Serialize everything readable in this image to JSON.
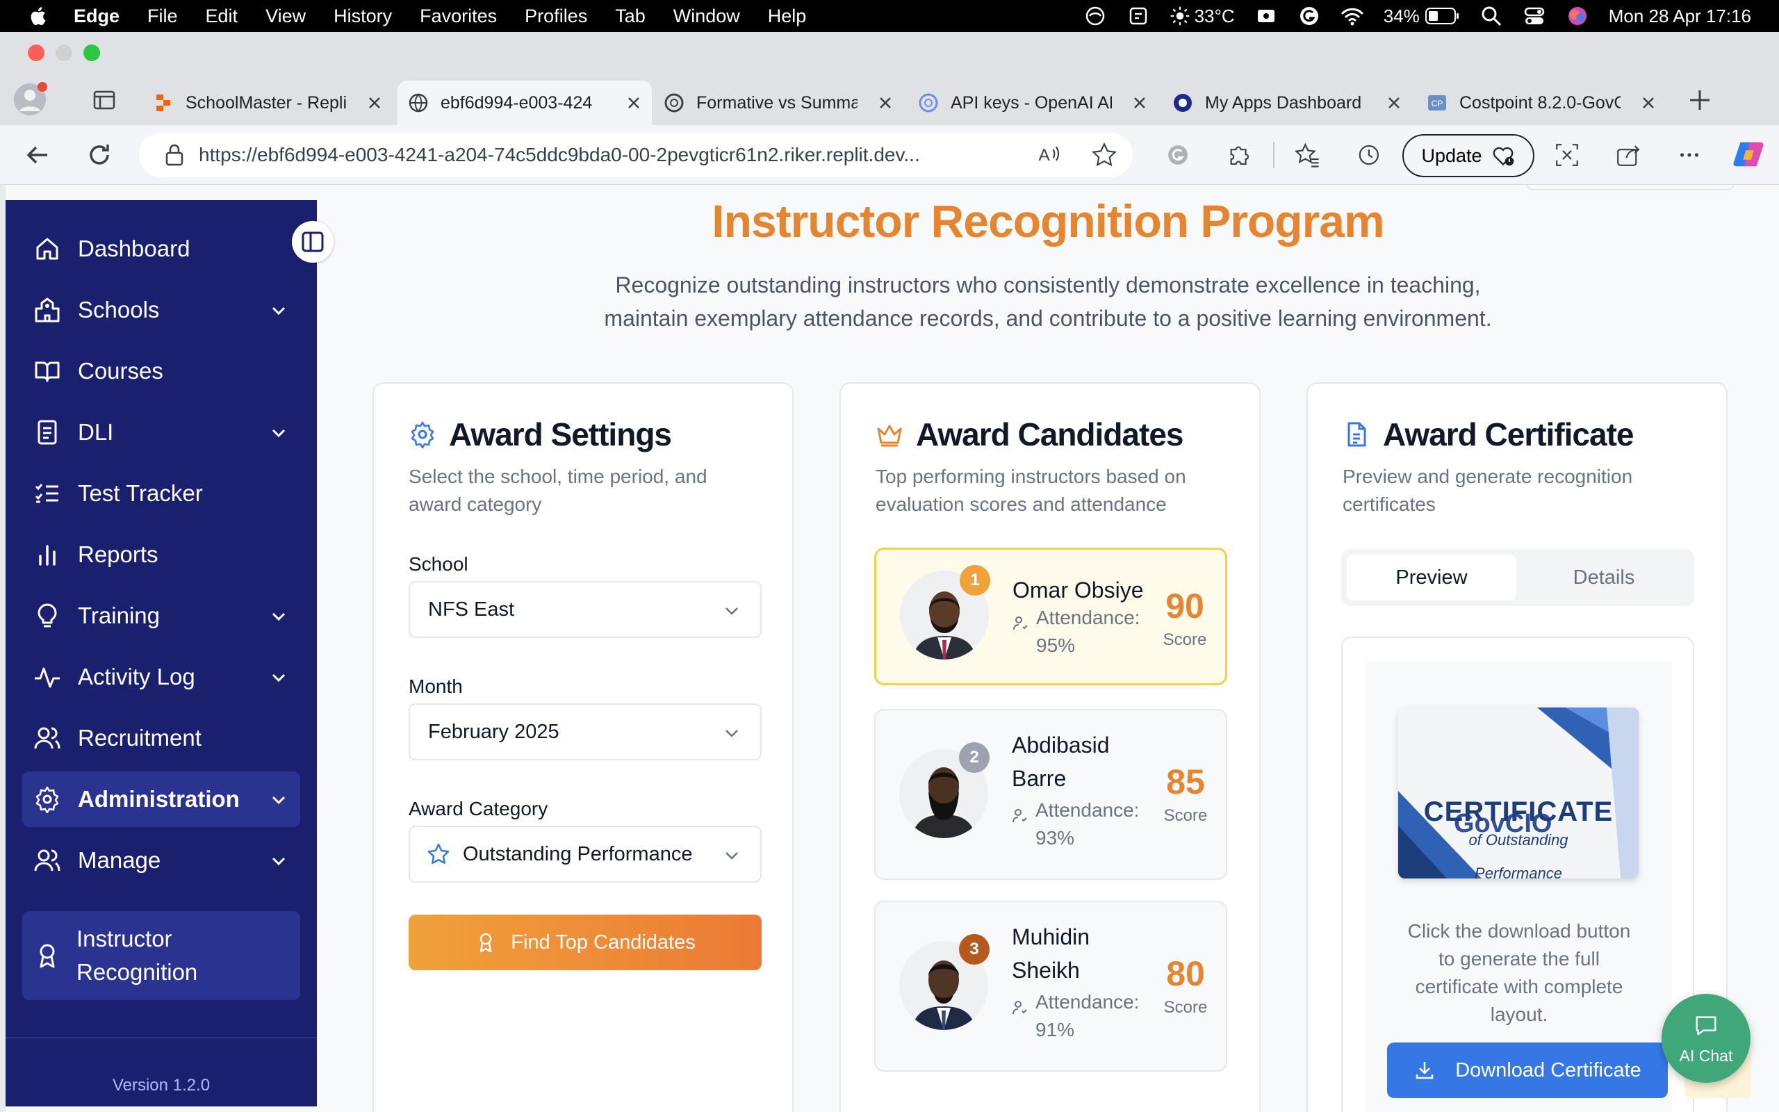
{
  "menubar": {
    "app": "Edge",
    "items": [
      "File",
      "Edit",
      "View",
      "History",
      "Favorites",
      "Profiles",
      "Tab",
      "Window",
      "Help"
    ],
    "temperature": "33°C",
    "battery": "34%",
    "datetime": "Mon 28 Apr  17:16"
  },
  "tabs": [
    {
      "title": "SchoolMaster - Replit",
      "icon": "replit-icon"
    },
    {
      "title": "ebf6d994-e003-424",
      "icon": "globe-icon"
    },
    {
      "title": "Formative vs Summat",
      "icon": "openai-icon"
    },
    {
      "title": "API keys - OpenAI AP",
      "icon": "openai-icon"
    },
    {
      "title": "My Apps Dashboard |",
      "icon": "okta-icon"
    },
    {
      "title": "Costpoint 8.2.0-GovC",
      "icon": "costpoint-icon"
    }
  ],
  "address": {
    "url": "https://ebf6d994-e003-4241-a204-74c5ddc9bda0-00-2pevgticr61n2.riker.replit.dev...",
    "update_label": "Update"
  },
  "sidebar": {
    "items": [
      {
        "label": "Dashboard",
        "icon": "home-icon"
      },
      {
        "label": "Schools",
        "icon": "school-icon"
      },
      {
        "label": "Courses",
        "icon": "book-icon"
      },
      {
        "label": "DLI",
        "icon": "document-icon"
      },
      {
        "label": "Test Tracker",
        "icon": "checklist-icon"
      },
      {
        "label": "Reports",
        "icon": "bar-chart-icon"
      },
      {
        "label": "Training",
        "icon": "lightbulb-icon"
      },
      {
        "label": "Activity Log",
        "icon": "activity-icon"
      },
      {
        "label": "Recruitment",
        "icon": "users-icon"
      },
      {
        "label": "Administration",
        "icon": "gear-icon"
      },
      {
        "label": "Manage",
        "icon": "users-icon"
      },
      {
        "label": "Instructor Recognition",
        "label_line1": "Instructor",
        "label_line2": "Recognition",
        "icon": "award-icon"
      }
    ],
    "version": "Version 1.2.0"
  },
  "header": {
    "title": "Instructor Recognition Program",
    "lead_line1": "Recognize outstanding instructors who consistently demonstrate excellence in teaching,",
    "lead_line2": "maintain exemplary attendance records, and contribute to a positive learning environment."
  },
  "settings": {
    "title": "Award Settings",
    "subtitle_line1": "Select the school, time period, and",
    "subtitle_line2": "award category",
    "school_label": "School",
    "school_value": "NFS East",
    "month_label": "Month",
    "month_value": "February 2025",
    "category_label": "Award Category",
    "category_value": "Outstanding Performance",
    "find_button": "Find Top Candidates"
  },
  "candidates": {
    "title": "Award Candidates",
    "subtitle_line1": "Top performing instructors based on",
    "subtitle_line2": "evaluation scores and attendance",
    "score_label": "Score",
    "list": [
      {
        "rank": "1",
        "name_line1": "Omar Obsiye",
        "name_line2": "",
        "att_line1": "Attendance:",
        "att_line2": "95%",
        "score": "90"
      },
      {
        "rank": "2",
        "name_line1": "Abdibasid",
        "name_line2": "Barre",
        "att_line1": "Attendance:",
        "att_line2": "93%",
        "score": "85"
      },
      {
        "rank": "3",
        "name_line1": "Muhidin",
        "name_line2": "Sheikh",
        "att_line1": "Attendance:",
        "att_line2": "91%",
        "score": "80"
      }
    ]
  },
  "certificate": {
    "title": "Award Certificate",
    "subtitle_line1": "Preview and generate recognition",
    "subtitle_line2": "certificates",
    "tab_preview": "Preview",
    "tab_details": "Details",
    "cert_heading": "CERTIFICATE",
    "cert_sub": "of Outstanding",
    "cert_perf": "Performance",
    "logo_text": "GovCIO",
    "note_line1": "Click the download button",
    "note_line2": "to generate the full",
    "note_line3": "certificate with complete",
    "note_line4": "layout.",
    "download_button": "Download Certificate"
  },
  "ai_chat": {
    "label": "AI Chat"
  },
  "colors": {
    "sidebar": "#1a1f6e",
    "accent": "#e6852f",
    "primary": "#3578e5",
    "chat": "#3fa77a"
  }
}
